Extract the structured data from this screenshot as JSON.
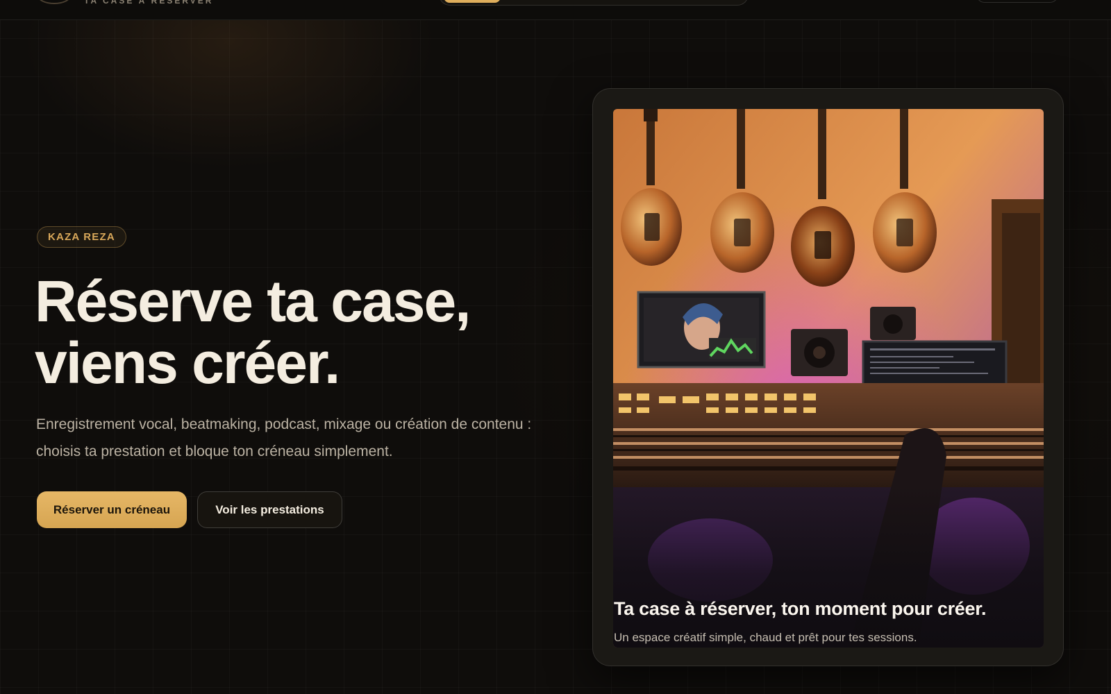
{
  "brand": {
    "tagline": "TA CASE À RÉSERVER"
  },
  "hero": {
    "badge": "KAZA REZA",
    "title_line1": "Réserve ta case,",
    "title_line2": "viens créer.",
    "subtitle_line1": "Enregistrement vocal, beatmaking, podcast, mixage ou création de contenu :",
    "subtitle_line2": "choisis ta prestation et bloque ton créneau simplement.",
    "primary_button": "Réserver un créneau",
    "secondary_button": "Voir les prestations"
  },
  "card": {
    "caption_title": "Ta case à réserver, ton moment pour créer.",
    "caption_subtitle": "Un espace créatif simple, chaud et prêt pour tes sessions."
  },
  "colors": {
    "background": "#0f0d0b",
    "accent": "#deae5c",
    "text": "#f4ede0",
    "muted": "#bcb3a4"
  },
  "icons": {
    "logo": "brand-logo-badge"
  }
}
